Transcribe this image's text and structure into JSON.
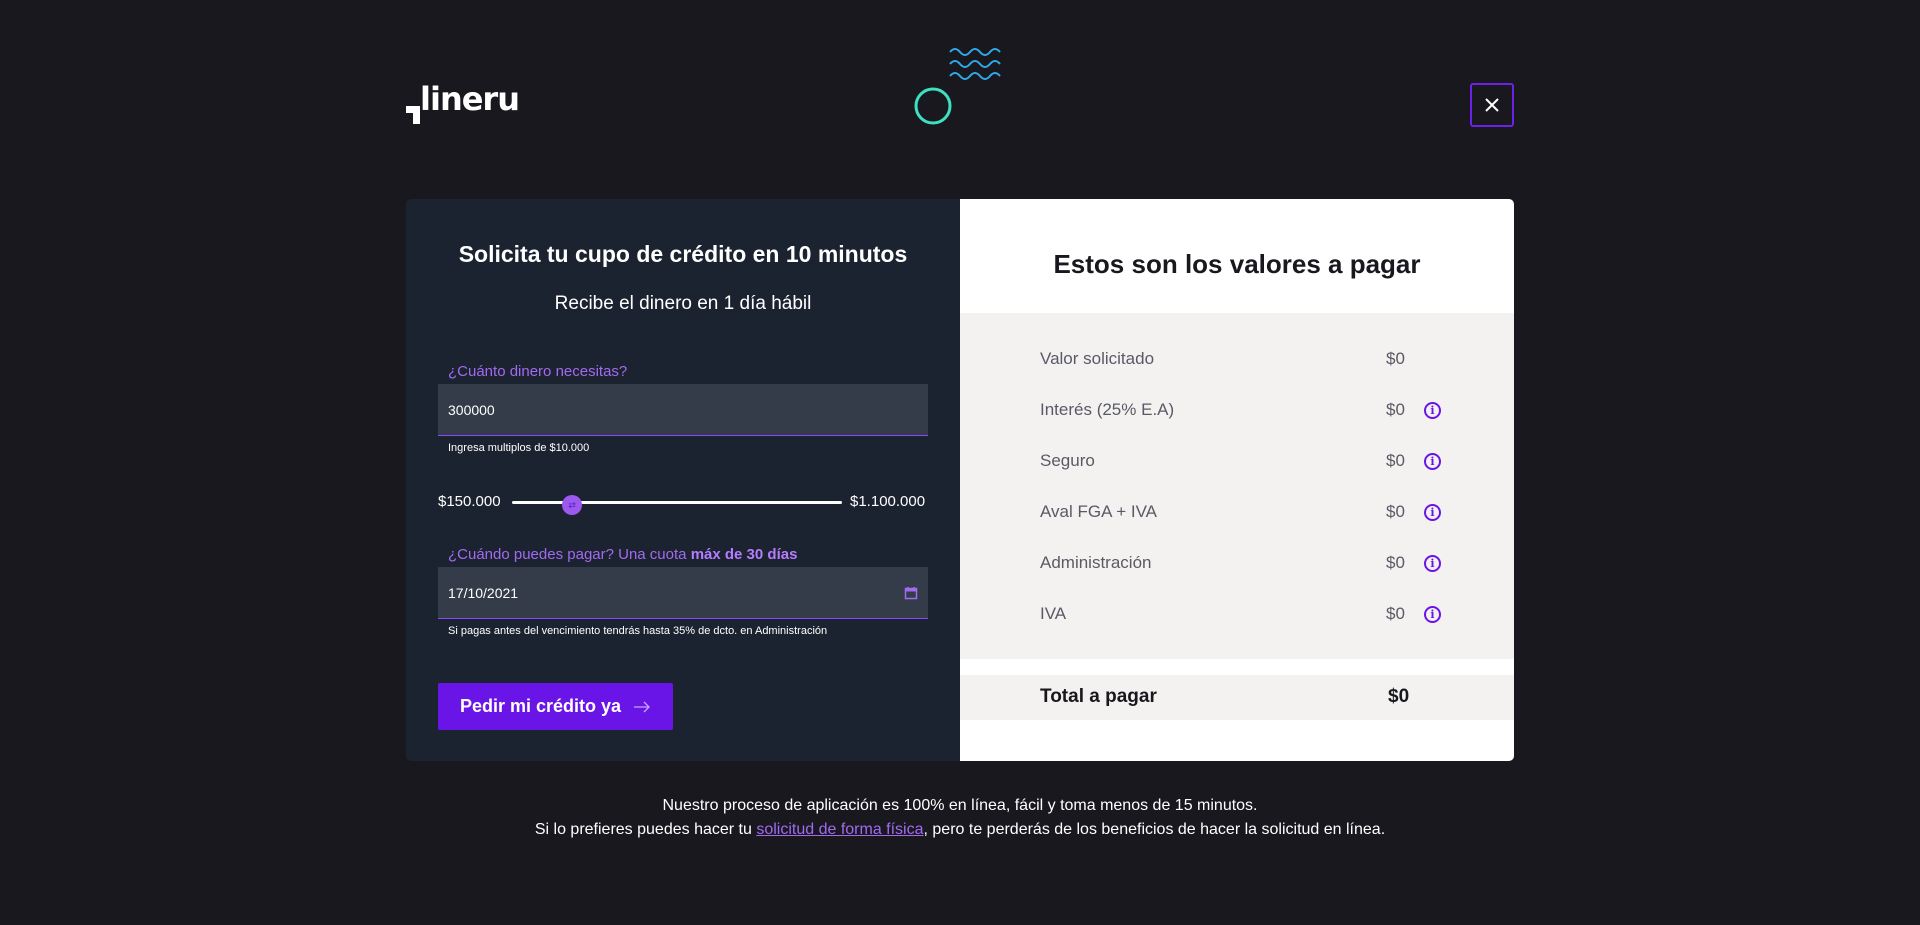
{
  "brand": {
    "logo_text": "lineru"
  },
  "header": {
    "close_icon": "close-icon"
  },
  "form": {
    "title": "Solicita tu cupo de crédito en 10 minutos",
    "subtitle": "Recibe el dinero en 1 día hábil",
    "amount_label": "¿Cuánto dinero necesitas?",
    "amount_value": "300000",
    "amount_hint": "Ingresa multiplos de $10.000",
    "slider": {
      "min_label": "$150.000",
      "max_label": "$1.100.000",
      "min": 150000,
      "max": 1100000,
      "value": 300000
    },
    "date_label_prefix": "¿Cuándo puedes pagar? Una cuota ",
    "date_label_bold": "máx de 30 días",
    "date_value": "17/10/2021",
    "date_hint": "Si pagas antes del vencimiento tendrás hasta 35% de dcto. en Administración",
    "submit_label": "Pedir mi crédito ya"
  },
  "summary": {
    "title": "Estos son los valores a pagar",
    "rows": [
      {
        "label": "Valor solicitado",
        "value": "$0",
        "info": false
      },
      {
        "label": "Interés (25% E.A)",
        "value": "$0",
        "info": true
      },
      {
        "label": "Seguro",
        "value": "$0",
        "info": true
      },
      {
        "label": "Aval FGA + IVA",
        "value": "$0",
        "info": true
      },
      {
        "label": "Administración",
        "value": "$0",
        "info": true
      },
      {
        "label": "IVA",
        "value": "$0",
        "info": true
      }
    ],
    "total_label": "Total a pagar",
    "total_value": "$0"
  },
  "footer": {
    "line1": "Nuestro proceso de aplicación es 100% en línea, fácil y toma menos de 15 minutos.",
    "line2_prefix": "Si lo prefieres puedes hacer tu ",
    "line2_link": "solicitud de forma física",
    "line2_suffix": ", pero te perderás de los beneficios de hacer la solicitud en línea."
  },
  "colors": {
    "accent": "#6a15e8",
    "accent_light": "#a26af0",
    "background": "#18181e",
    "panel": "#1c2330"
  }
}
